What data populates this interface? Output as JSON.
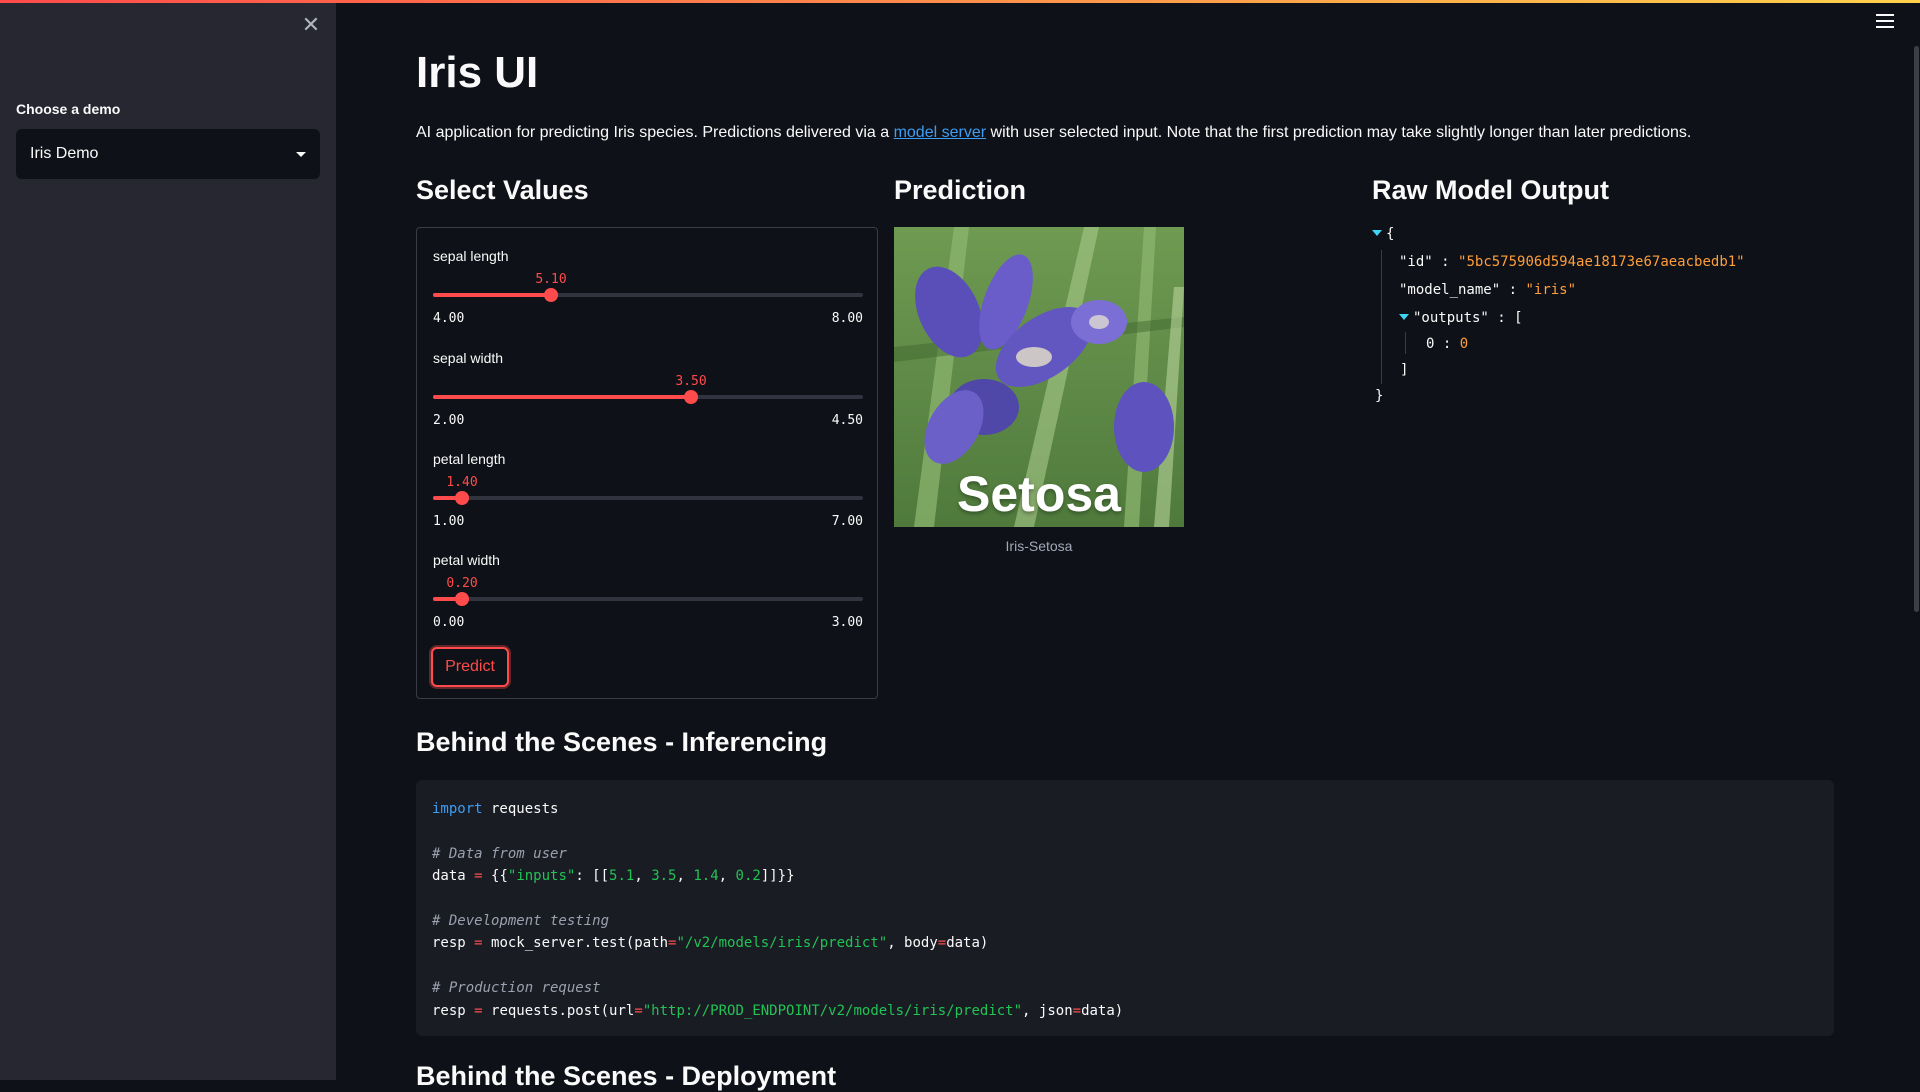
{
  "sidebar": {
    "close_glyph": "✕",
    "select_label": "Choose a demo",
    "select_value": "Iris Demo"
  },
  "main": {
    "title": "Iris UI",
    "description_before": "AI application for predicting Iris species. Predictions delivered via a ",
    "description_link": "model server",
    "description_after": " with user selected input. Note that the first prediction may take slightly longer than later predictions.",
    "sections": {
      "select_values": "Select Values",
      "prediction": "Prediction",
      "raw_output": "Raw Model Output",
      "inferencing": "Behind the Scenes - Inferencing",
      "deployment": "Behind the Scenes - Deployment"
    }
  },
  "sliders": [
    {
      "label": "sepal length",
      "value": "5.10",
      "min": "4.00",
      "max": "8.00",
      "fraction": 0.275
    },
    {
      "label": "sepal width",
      "value": "3.50",
      "min": "2.00",
      "max": "4.50",
      "fraction": 0.6
    },
    {
      "label": "petal length",
      "value": "1.40",
      "min": "1.00",
      "max": "7.00",
      "fraction": 0.0667
    },
    {
      "label": "petal width",
      "value": "0.20",
      "min": "0.00",
      "max": "3.00",
      "fraction": 0.0667
    }
  ],
  "predict_button": "Predict",
  "prediction": {
    "image_text": "Setosa",
    "caption": "Iris-Setosa"
  },
  "json_output": {
    "open_brace": "{",
    "close_brace": "}",
    "id_key": "\"id\"",
    "id_value": "\"5bc575906d594ae18173e67aeacbedb1\"",
    "model_key": "\"model_name\"",
    "model_value": "\"iris\"",
    "outputs_key": "\"outputs\"",
    "open_bracket": "[",
    "close_bracket": "]",
    "item_index": "0",
    "item_value": "0",
    "sep": ":"
  },
  "code": {
    "line1_kw": "import",
    "line1_rest": " requests",
    "comment1": "# Data from user",
    "data_var": "data ",
    "data_eq": "=",
    "data_open": " {{",
    "data_key": "\"inputs\"",
    "data_mid": ": [[",
    "n1": "5.1",
    "n2": "3.5",
    "n3": "1.4",
    "n4": "0.2",
    "comma": ", ",
    "data_close": "]]}}",
    "comment2": "# Development testing",
    "resp_var": "resp ",
    "eq": "=",
    "test_call": " mock_server.test(path",
    "test_path": "\"/v2/models/iris/predict\"",
    "test_body": ", body",
    "test_data": "data)",
    "comment3": "# Production request",
    "post_call": " requests.post(url",
    "post_url": "\"http://PROD_ENDPOINT/v2/models/iris/predict\"",
    "post_json": ", json",
    "post_data": "data)"
  }
}
